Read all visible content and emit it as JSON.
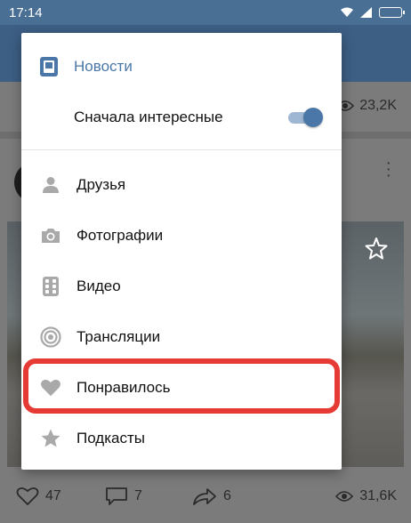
{
  "status_bar": {
    "time": "17:14"
  },
  "post": {
    "top_views": "23,2K",
    "likes": "47",
    "comments": "7",
    "shares": "6",
    "views": "31,6K"
  },
  "menu": {
    "title": "Новости",
    "sort_option": "Сначала интересные",
    "sort_enabled": true,
    "items": [
      {
        "label": "Друзья",
        "icon": "person-icon"
      },
      {
        "label": "Фотографии",
        "icon": "camera-icon"
      },
      {
        "label": "Видео",
        "icon": "film-icon"
      },
      {
        "label": "Трансляции",
        "icon": "broadcast-icon"
      },
      {
        "label": "Понравилось",
        "icon": "heart-icon"
      },
      {
        "label": "Подкасты",
        "icon": "star-icon"
      }
    ]
  },
  "colors": {
    "accent": "#4a77a8",
    "highlight": "#e63b35",
    "icon_gray": "#a9a9a9"
  }
}
